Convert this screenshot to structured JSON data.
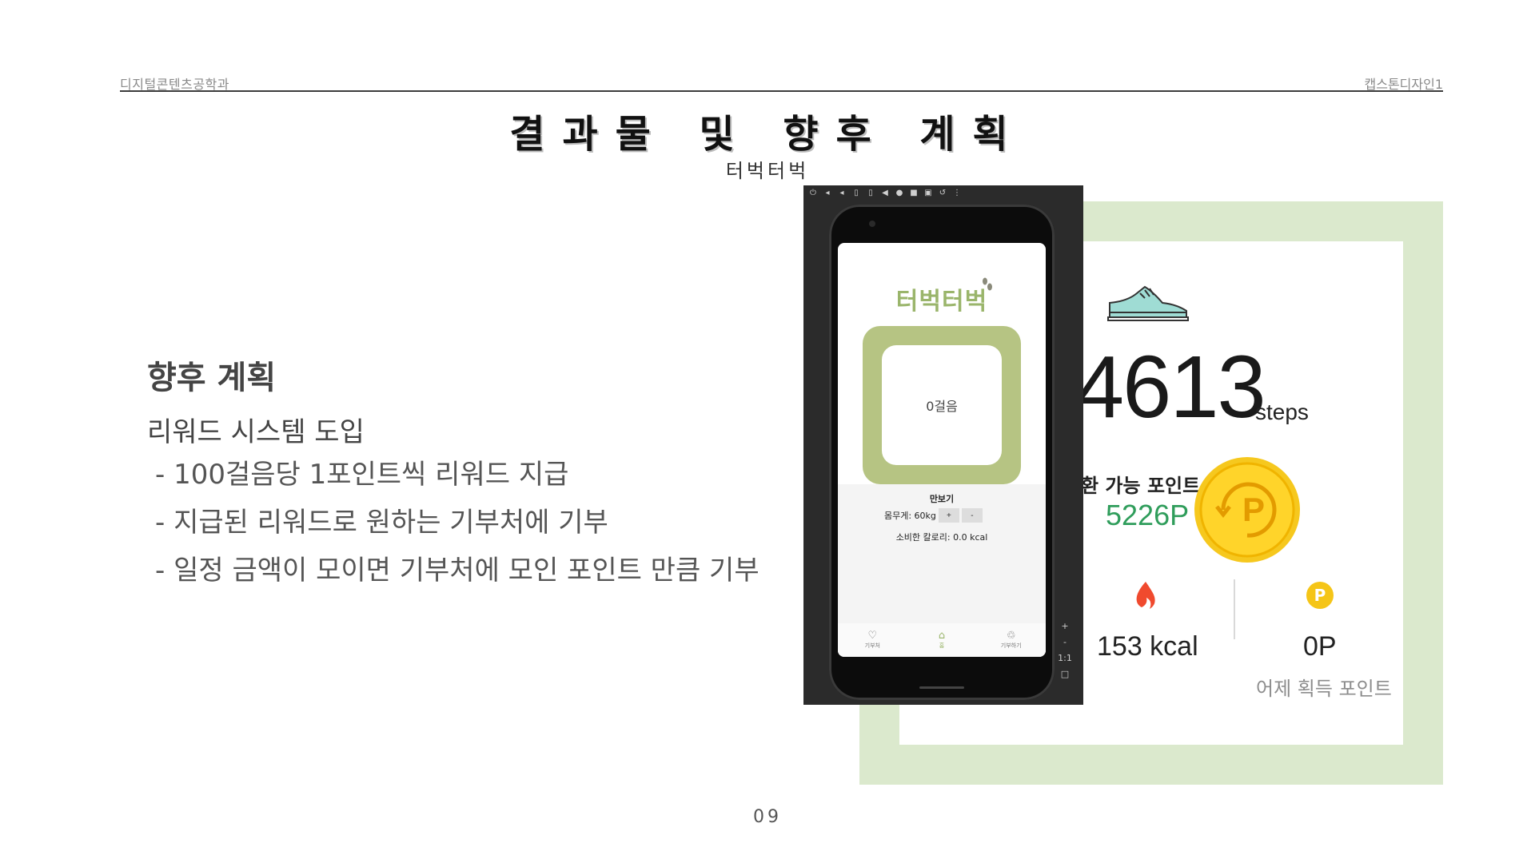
{
  "header": {
    "department": "디지털콘텐츠공학과",
    "course": "캡스톤디자인1",
    "title": "결과물 및 향후 계획",
    "subtitle": "터벅터벅"
  },
  "plan": {
    "heading": "향후 계획",
    "subheading": "리워드 시스템 도입",
    "bullets": [
      "- 100걸음당 1포인트씩 리워드 지급",
      "- 지급된 리워드로 원하는 기부처에 기부",
      "- 일정 금액이 모이면 기부처에 모인 포인트 만큼 기부"
    ]
  },
  "stats_screenshot": {
    "steps": "4613",
    "steps_unit": "steps",
    "points_label": "환 가능 포인트",
    "points_value": "5226P",
    "coin_letter": "P",
    "kcal": "153 kcal",
    "p_badge": "P",
    "yesterday_points": "0P",
    "yesterday_label": "어제 획득 포인트",
    "accent_color": "#2f9d5b"
  },
  "emulator": {
    "toolbar_icons": [
      "power-icon",
      "volume-up-icon",
      "volume-down-icon",
      "rotate-left-icon",
      "rotate-right-icon",
      "back-icon",
      "home-icon",
      "overview-icon",
      "camera-icon",
      "replay-icon",
      "more-icon"
    ],
    "side_tools": [
      "+",
      "-",
      "1:1",
      "□"
    ],
    "app": {
      "logo": "터벅터벅",
      "step_counter": "0걸음",
      "pedometer_title": "만보기",
      "weight_label": "몸무게: 60kg",
      "plus_label": "+",
      "minus_label": "-",
      "calorie_text": "소비한 칼로리: 0.0 kcal",
      "nav": [
        {
          "label": "기부처",
          "icon": "donate-icon"
        },
        {
          "label": "홈",
          "icon": "home-icon"
        },
        {
          "label": "기부하기",
          "icon": "gift-icon"
        }
      ],
      "brand_color": "#9ab56b",
      "box_color": "#b6c483"
    }
  },
  "page_number": "09"
}
